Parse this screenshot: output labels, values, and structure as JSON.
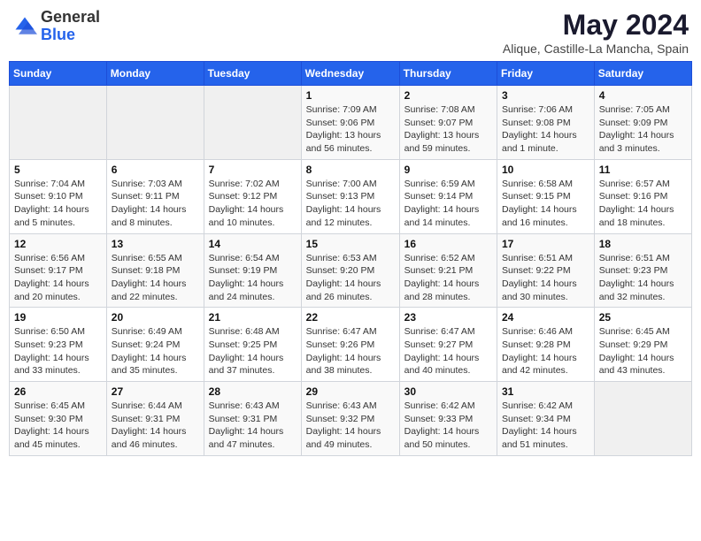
{
  "header": {
    "logo_general": "General",
    "logo_blue": "Blue",
    "month_title": "May 2024",
    "location": "Alique, Castille-La Mancha, Spain"
  },
  "days_of_week": [
    "Sunday",
    "Monday",
    "Tuesday",
    "Wednesday",
    "Thursday",
    "Friday",
    "Saturday"
  ],
  "weeks": [
    [
      {
        "day": "",
        "info": ""
      },
      {
        "day": "",
        "info": ""
      },
      {
        "day": "",
        "info": ""
      },
      {
        "day": "1",
        "info": "Sunrise: 7:09 AM\nSunset: 9:06 PM\nDaylight: 13 hours\nand 56 minutes."
      },
      {
        "day": "2",
        "info": "Sunrise: 7:08 AM\nSunset: 9:07 PM\nDaylight: 13 hours\nand 59 minutes."
      },
      {
        "day": "3",
        "info": "Sunrise: 7:06 AM\nSunset: 9:08 PM\nDaylight: 14 hours\nand 1 minute."
      },
      {
        "day": "4",
        "info": "Sunrise: 7:05 AM\nSunset: 9:09 PM\nDaylight: 14 hours\nand 3 minutes."
      }
    ],
    [
      {
        "day": "5",
        "info": "Sunrise: 7:04 AM\nSunset: 9:10 PM\nDaylight: 14 hours\nand 5 minutes."
      },
      {
        "day": "6",
        "info": "Sunrise: 7:03 AM\nSunset: 9:11 PM\nDaylight: 14 hours\nand 8 minutes."
      },
      {
        "day": "7",
        "info": "Sunrise: 7:02 AM\nSunset: 9:12 PM\nDaylight: 14 hours\nand 10 minutes."
      },
      {
        "day": "8",
        "info": "Sunrise: 7:00 AM\nSunset: 9:13 PM\nDaylight: 14 hours\nand 12 minutes."
      },
      {
        "day": "9",
        "info": "Sunrise: 6:59 AM\nSunset: 9:14 PM\nDaylight: 14 hours\nand 14 minutes."
      },
      {
        "day": "10",
        "info": "Sunrise: 6:58 AM\nSunset: 9:15 PM\nDaylight: 14 hours\nand 16 minutes."
      },
      {
        "day": "11",
        "info": "Sunrise: 6:57 AM\nSunset: 9:16 PM\nDaylight: 14 hours\nand 18 minutes."
      }
    ],
    [
      {
        "day": "12",
        "info": "Sunrise: 6:56 AM\nSunset: 9:17 PM\nDaylight: 14 hours\nand 20 minutes."
      },
      {
        "day": "13",
        "info": "Sunrise: 6:55 AM\nSunset: 9:18 PM\nDaylight: 14 hours\nand 22 minutes."
      },
      {
        "day": "14",
        "info": "Sunrise: 6:54 AM\nSunset: 9:19 PM\nDaylight: 14 hours\nand 24 minutes."
      },
      {
        "day": "15",
        "info": "Sunrise: 6:53 AM\nSunset: 9:20 PM\nDaylight: 14 hours\nand 26 minutes."
      },
      {
        "day": "16",
        "info": "Sunrise: 6:52 AM\nSunset: 9:21 PM\nDaylight: 14 hours\nand 28 minutes."
      },
      {
        "day": "17",
        "info": "Sunrise: 6:51 AM\nSunset: 9:22 PM\nDaylight: 14 hours\nand 30 minutes."
      },
      {
        "day": "18",
        "info": "Sunrise: 6:51 AM\nSunset: 9:23 PM\nDaylight: 14 hours\nand 32 minutes."
      }
    ],
    [
      {
        "day": "19",
        "info": "Sunrise: 6:50 AM\nSunset: 9:23 PM\nDaylight: 14 hours\nand 33 minutes."
      },
      {
        "day": "20",
        "info": "Sunrise: 6:49 AM\nSunset: 9:24 PM\nDaylight: 14 hours\nand 35 minutes."
      },
      {
        "day": "21",
        "info": "Sunrise: 6:48 AM\nSunset: 9:25 PM\nDaylight: 14 hours\nand 37 minutes."
      },
      {
        "day": "22",
        "info": "Sunrise: 6:47 AM\nSunset: 9:26 PM\nDaylight: 14 hours\nand 38 minutes."
      },
      {
        "day": "23",
        "info": "Sunrise: 6:47 AM\nSunset: 9:27 PM\nDaylight: 14 hours\nand 40 minutes."
      },
      {
        "day": "24",
        "info": "Sunrise: 6:46 AM\nSunset: 9:28 PM\nDaylight: 14 hours\nand 42 minutes."
      },
      {
        "day": "25",
        "info": "Sunrise: 6:45 AM\nSunset: 9:29 PM\nDaylight: 14 hours\nand 43 minutes."
      }
    ],
    [
      {
        "day": "26",
        "info": "Sunrise: 6:45 AM\nSunset: 9:30 PM\nDaylight: 14 hours\nand 45 minutes."
      },
      {
        "day": "27",
        "info": "Sunrise: 6:44 AM\nSunset: 9:31 PM\nDaylight: 14 hours\nand 46 minutes."
      },
      {
        "day": "28",
        "info": "Sunrise: 6:43 AM\nSunset: 9:31 PM\nDaylight: 14 hours\nand 47 minutes."
      },
      {
        "day": "29",
        "info": "Sunrise: 6:43 AM\nSunset: 9:32 PM\nDaylight: 14 hours\nand 49 minutes."
      },
      {
        "day": "30",
        "info": "Sunrise: 6:42 AM\nSunset: 9:33 PM\nDaylight: 14 hours\nand 50 minutes."
      },
      {
        "day": "31",
        "info": "Sunrise: 6:42 AM\nSunset: 9:34 PM\nDaylight: 14 hours\nand 51 minutes."
      },
      {
        "day": "",
        "info": ""
      }
    ]
  ]
}
